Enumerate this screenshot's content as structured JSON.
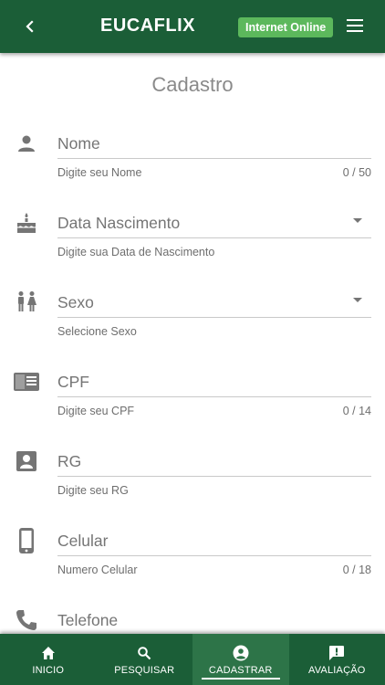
{
  "header": {
    "title": "EUCAFLIX",
    "status": "Internet Online",
    "back_icon": "chevron-left-icon",
    "menu_icon": "hamburger-menu-icon"
  },
  "page": {
    "title": "Cadastro"
  },
  "form": {
    "nome": {
      "icon": "person-icon",
      "placeholder": "Nome",
      "value": "",
      "hint": "Digite seu Nome",
      "counter": "0 / 50"
    },
    "nascimento": {
      "icon": "cake-icon",
      "placeholder": "Data Nascimento",
      "value": "",
      "hint": "Digite sua Data de Nascimento",
      "dropdown_icon": "caret-down-icon"
    },
    "sexo": {
      "icon": "wc-icon",
      "placeholder": "Sexo",
      "value": "",
      "hint": "Selecione Sexo",
      "dropdown_icon": "caret-down-icon"
    },
    "cpf": {
      "icon": "id-card-icon",
      "placeholder": "CPF",
      "value": "",
      "hint": "Digite seu CPF",
      "counter": "0 / 14"
    },
    "rg": {
      "icon": "contact-card-icon",
      "placeholder": "RG",
      "value": "",
      "hint": "Digite seu RG"
    },
    "celular": {
      "icon": "smartphone-icon",
      "placeholder": "Celular",
      "value": "",
      "hint": "Numero Celular",
      "counter": "0 / 18"
    },
    "telefone": {
      "icon": "phone-icon",
      "placeholder": "Telefone",
      "value": ""
    }
  },
  "nav": {
    "items": [
      {
        "label": "INICIO",
        "icon": "home-icon",
        "active": false
      },
      {
        "label": "PESQUISAR",
        "icon": "search-icon",
        "active": false
      },
      {
        "label": "CADASTRAR",
        "icon": "account-circle-icon",
        "active": true
      },
      {
        "label": "AVALIAÇÃO",
        "icon": "feedback-icon",
        "active": false
      }
    ]
  },
  "colors": {
    "primary": "#1b5e37",
    "nav_active": "#2d7448",
    "status_badge": "#5cb85c",
    "icon_gray": "#757575"
  }
}
